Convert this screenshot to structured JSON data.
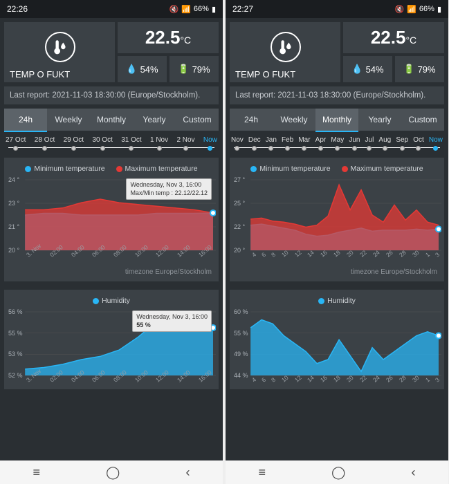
{
  "screens": [
    {
      "status": {
        "time": "22:26",
        "battery": "66%"
      },
      "device": {
        "name": "TEMP O FUKT",
        "temp": "22.5",
        "tempUnit": "°C",
        "humidity": "54%",
        "batt": "79%"
      },
      "lastReport": "Last report: 2021-11-03 18:30:00 (Europe/Stockholm).",
      "tabs": [
        "24h",
        "Weekly",
        "Monthly",
        "Yearly",
        "Custom"
      ],
      "activeTab": 0,
      "dates": [
        "27 Oct",
        "28 Oct",
        "29 Oct",
        "30 Oct",
        "31 Oct",
        "1 Nov",
        "2 Nov",
        "Now"
      ],
      "tempLegend": {
        "min": "Minimum temperature",
        "max": "Maximum temperature"
      },
      "tempTooltip": {
        "title": "Wednesday, Nov 3, 16:00",
        "line": "Max/Min temp : 22.12/22.12"
      },
      "tz": "timezone Europe/Stockholm",
      "humLegend": "Humidity",
      "humTooltip": {
        "title": "Wednesday, Nov 3, 16:00",
        "line": "55 %"
      }
    },
    {
      "status": {
        "time": "22:27",
        "battery": "66%"
      },
      "device": {
        "name": "TEMP O FUKT",
        "temp": "22.5",
        "tempUnit": "°C",
        "humidity": "54%",
        "batt": "79%"
      },
      "lastReport": "Last report: 2021-11-03 18:30:00 (Europe/Stockholm).",
      "tabs": [
        "24h",
        "Weekly",
        "Monthly",
        "Yearly",
        "Custom"
      ],
      "activeTab": 2,
      "dates": [
        "Nov",
        "Dec",
        "Jan",
        "Feb",
        "Mar",
        "Apr",
        "May",
        "Jun",
        "Jul",
        "Aug",
        "Sep",
        "Oct",
        "Now"
      ],
      "tempLegend": {
        "min": "Minimum temperature",
        "max": "Maximum temperature"
      },
      "tz": "timezone Europe/Stockholm",
      "humLegend": "Humidity"
    }
  ],
  "chart_data": [
    {
      "screen": 0,
      "name": "temperature",
      "type": "area",
      "x": [
        "3. Nov",
        "02:00",
        "04:00",
        "06:00",
        "08:00",
        "10:00",
        "12:00",
        "14:00",
        "16:00"
      ],
      "ylim": [
        20,
        24
      ],
      "ylabel": "°",
      "series": [
        {
          "name": "Max",
          "color": "#e53935",
          "values": [
            22.3,
            22.3,
            22.4,
            22.7,
            22.9,
            22.7,
            22.6,
            22.5,
            22.4,
            22.3,
            22.12
          ]
        },
        {
          "name": "Min",
          "color": "#29b6f6",
          "values": [
            22.0,
            22.1,
            22.1,
            22.0,
            22.0,
            22.0,
            22.0,
            22.1,
            22.1,
            22.1,
            22.12
          ]
        }
      ],
      "tooltip": {
        "x": "Wednesday, Nov 3, 16:00",
        "text": "Max/Min temp : 22.12/22.12"
      }
    },
    {
      "screen": 0,
      "name": "humidity",
      "type": "area",
      "x": [
        "3. Nov",
        "02:00",
        "04:00",
        "06:00",
        "08:00",
        "10:00",
        "12:00",
        "14:00",
        "16:00"
      ],
      "ylim": [
        52,
        56
      ],
      "ylabel": "%",
      "series": [
        {
          "name": "Humidity",
          "color": "#29b6f6",
          "values": [
            52.4,
            52.5,
            52.7,
            53.0,
            53.2,
            53.6,
            54.4,
            55.4,
            55.2,
            55.3,
            55.0
          ]
        }
      ],
      "tooltip": {
        "x": "Wednesday, Nov 3, 16:00",
        "text": "55 %"
      }
    },
    {
      "screen": 1,
      "name": "temperature",
      "type": "area",
      "x": [
        "4",
        "6",
        "8",
        "10",
        "12",
        "14",
        "16",
        "18",
        "20",
        "22",
        "24",
        "26",
        "28",
        "30",
        "1",
        "3"
      ],
      "ylim": [
        20,
        27
      ],
      "ylabel": "°",
      "series": [
        {
          "name": "Max",
          "color": "#e53935",
          "values": [
            23.1,
            23.2,
            22.9,
            22.8,
            22.6,
            22.3,
            22.5,
            23.4,
            26.5,
            24.0,
            26.0,
            23.5,
            22.8,
            24.5,
            23.0,
            24.0,
            22.8,
            22.5
          ]
        },
        {
          "name": "Min",
          "color": "#29b6f6",
          "values": [
            22.5,
            22.6,
            22.4,
            22.2,
            22.0,
            21.6,
            21.4,
            21.5,
            21.8,
            22.0,
            22.2,
            21.9,
            22.0,
            22.0,
            22.0,
            22.1,
            22.0,
            22.1
          ]
        }
      ]
    },
    {
      "screen": 1,
      "name": "humidity",
      "type": "area",
      "x": [
        "4",
        "6",
        "8",
        "10",
        "12",
        "14",
        "16",
        "18",
        "20",
        "22",
        "24",
        "26",
        "28",
        "30",
        "1",
        "3"
      ],
      "ylim": [
        44,
        60
      ],
      "ylabel": "%",
      "series": [
        {
          "name": "Humidity",
          "color": "#29b6f6",
          "values": [
            56,
            58,
            57,
            54,
            52,
            50,
            47,
            48,
            53,
            49,
            45,
            51,
            48,
            50,
            52,
            54,
            55,
            54
          ]
        }
      ]
    }
  ]
}
